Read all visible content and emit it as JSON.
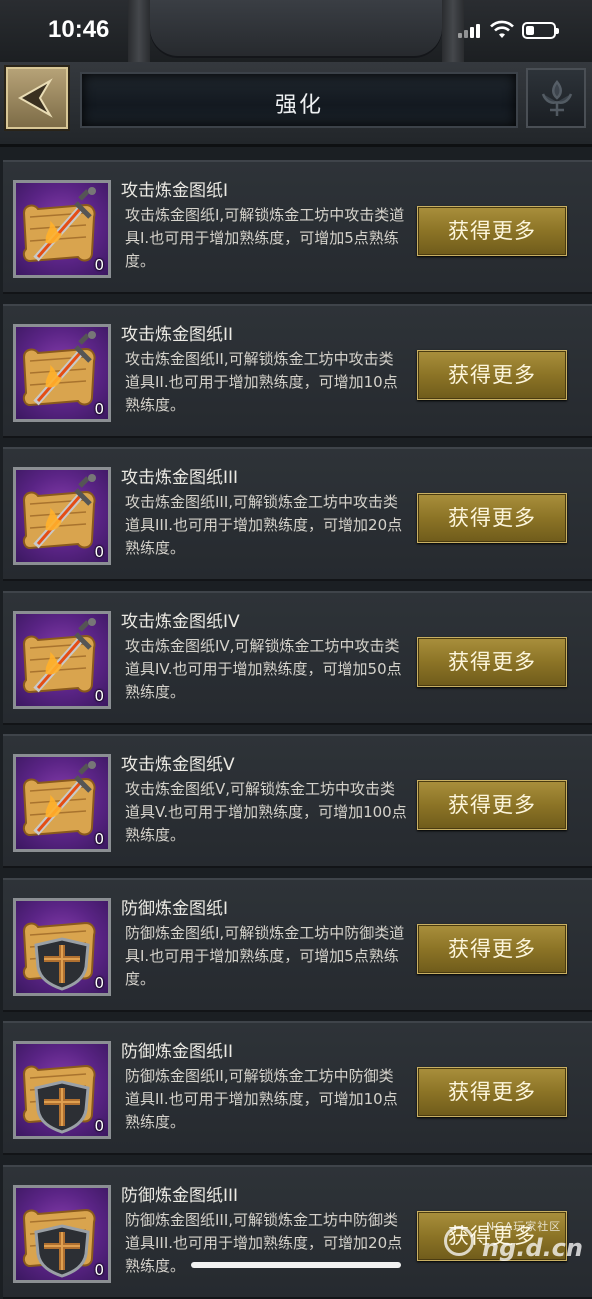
{
  "status_bar": {
    "time": "10:46"
  },
  "header": {
    "title": "强化"
  },
  "items": [
    {
      "name": "攻击炼金图纸I",
      "description": "攻击炼金图纸I,可解锁炼金工坊中攻击类道具I.也可用于增加熟练度，可增加5点熟练度。",
      "count": "0",
      "button": "获得更多",
      "icon": "scroll-sword-icon"
    },
    {
      "name": "攻击炼金图纸II",
      "description": "攻击炼金图纸II,可解锁炼金工坊中攻击类道具II.也可用于增加熟练度，可增加10点熟练度。",
      "count": "0",
      "button": "获得更多",
      "icon": "scroll-sword-icon"
    },
    {
      "name": "攻击炼金图纸III",
      "description": "攻击炼金图纸III,可解锁炼金工坊中攻击类道具III.也可用于增加熟练度，可增加20点熟练度。",
      "count": "0",
      "button": "获得更多",
      "icon": "scroll-sword-icon"
    },
    {
      "name": "攻击炼金图纸IV",
      "description": "攻击炼金图纸IV,可解锁炼金工坊中攻击类道具IV.也可用于增加熟练度，可增加50点熟练度。",
      "count": "0",
      "button": "获得更多",
      "icon": "scroll-sword-icon"
    },
    {
      "name": "攻击炼金图纸V",
      "description": "攻击炼金图纸V,可解锁炼金工坊中攻击类道具V.也可用于增加熟练度，可增加100点熟练度。",
      "count": "0",
      "button": "获得更多",
      "icon": "scroll-sword-icon"
    },
    {
      "name": "防御炼金图纸I",
      "description": "防御炼金图纸I,可解锁炼金工坊中防御类道具I.也可用于增加熟练度，可增加5点熟练度。",
      "count": "0",
      "button": "获得更多",
      "icon": "scroll-shield-icon"
    },
    {
      "name": "防御炼金图纸II",
      "description": "防御炼金图纸II,可解锁炼金工坊中防御类道具II.也可用于增加熟练度，可增加10点熟练度。",
      "count": "0",
      "button": "获得更多",
      "icon": "scroll-shield-icon"
    },
    {
      "name": "防御炼金图纸III",
      "description": "防御炼金图纸III,可解锁炼金工坊中防御类道具III.也可用于增加熟练度，可增加20点熟练度。",
      "count": "0",
      "button": "获得更多",
      "icon": "scroll-shield-icon"
    }
  ],
  "watermark": {
    "top": "NGA玩家社区",
    "main": "ng.d.cn"
  }
}
